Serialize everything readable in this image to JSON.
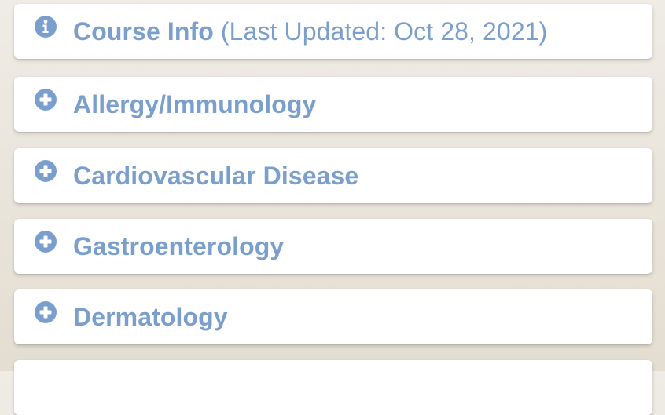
{
  "colors": {
    "accent": "#7b9fcd",
    "panel_bg": "#ffffff",
    "page_bg": "#ebe7df"
  },
  "course_info": {
    "icon": "info-circle-icon",
    "title": "Course Info",
    "subtitle": "(Last Updated: Oct 28, 2021)"
  },
  "sections": [
    {
      "icon": "plus-circle-icon",
      "label": "Allergy/Immunology"
    },
    {
      "icon": "plus-circle-icon",
      "label": "Cardiovascular Disease"
    },
    {
      "icon": "plus-circle-icon",
      "label": "Gastroenterology"
    },
    {
      "icon": "plus-circle-icon",
      "label": "Dermatology"
    },
    {
      "icon": "plus-circle-icon",
      "label": ""
    }
  ]
}
